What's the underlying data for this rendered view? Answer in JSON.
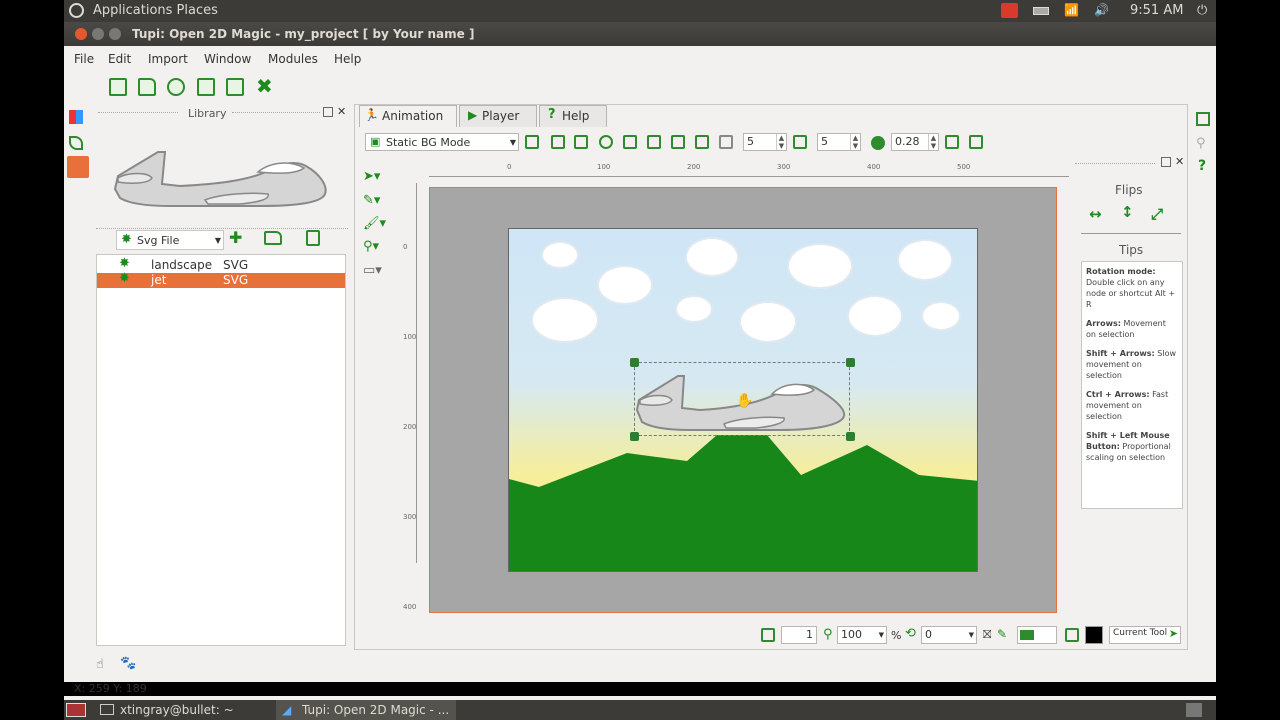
{
  "topbar": {
    "menu": "Applications  Places",
    "time": "9:51 AM"
  },
  "window": {
    "title": "Tupi: Open 2D Magic - my_project [ by Your name ]"
  },
  "menubar": {
    "file": "File",
    "edit": "Edit",
    "import": "Import",
    "window": "Window",
    "modules": "Modules",
    "help": "Help"
  },
  "library": {
    "title": "Library",
    "type_select": "Svg File",
    "items": [
      {
        "name": "landscape",
        "type": "SVG"
      },
      {
        "name": "jet",
        "type": "SVG"
      }
    ]
  },
  "tabs": {
    "animation": "Animation",
    "player": "Player",
    "help": "Help"
  },
  "canvas_toolbar": {
    "mode": "Static BG Mode",
    "val1": "5",
    "val2": "5",
    "val3": "0.28"
  },
  "ruler": {
    "top": [
      "0",
      "100",
      "200",
      "300",
      "400",
      "500"
    ],
    "left": [
      "0",
      "100",
      "200",
      "300",
      "400"
    ]
  },
  "flips": {
    "title": "Flips"
  },
  "tips": {
    "title": "Tips",
    "items": [
      {
        "b": "Rotation mode:",
        "t": " Double click on any node or shortcut Alt + R"
      },
      {
        "b": "Arrows:",
        "t": " Movement on selection"
      },
      {
        "b": "Shift + Arrows:",
        "t": " Slow movement on selection"
      },
      {
        "b": "Ctrl + Arrows:",
        "t": " Fast movement on selection"
      },
      {
        "b": "Shift + Left Mouse Button:",
        "t": " Proportional scaling on selection"
      }
    ]
  },
  "bottom_bar": {
    "frame": "1",
    "zoom": "100",
    "pct": "%",
    "rotation": "0",
    "current_tool": "Current Tool"
  },
  "status": {
    "coords": "X: 259 Y: 189"
  },
  "taskbar": {
    "terminal": "xtingray@bullet: ~",
    "app": "Tupi: Open 2D Magic - ..."
  },
  "colors": {
    "accent": "#e8703a",
    "green": "#2e8b2e",
    "sky": "#cfe6f6",
    "mountain": "#17871a"
  }
}
